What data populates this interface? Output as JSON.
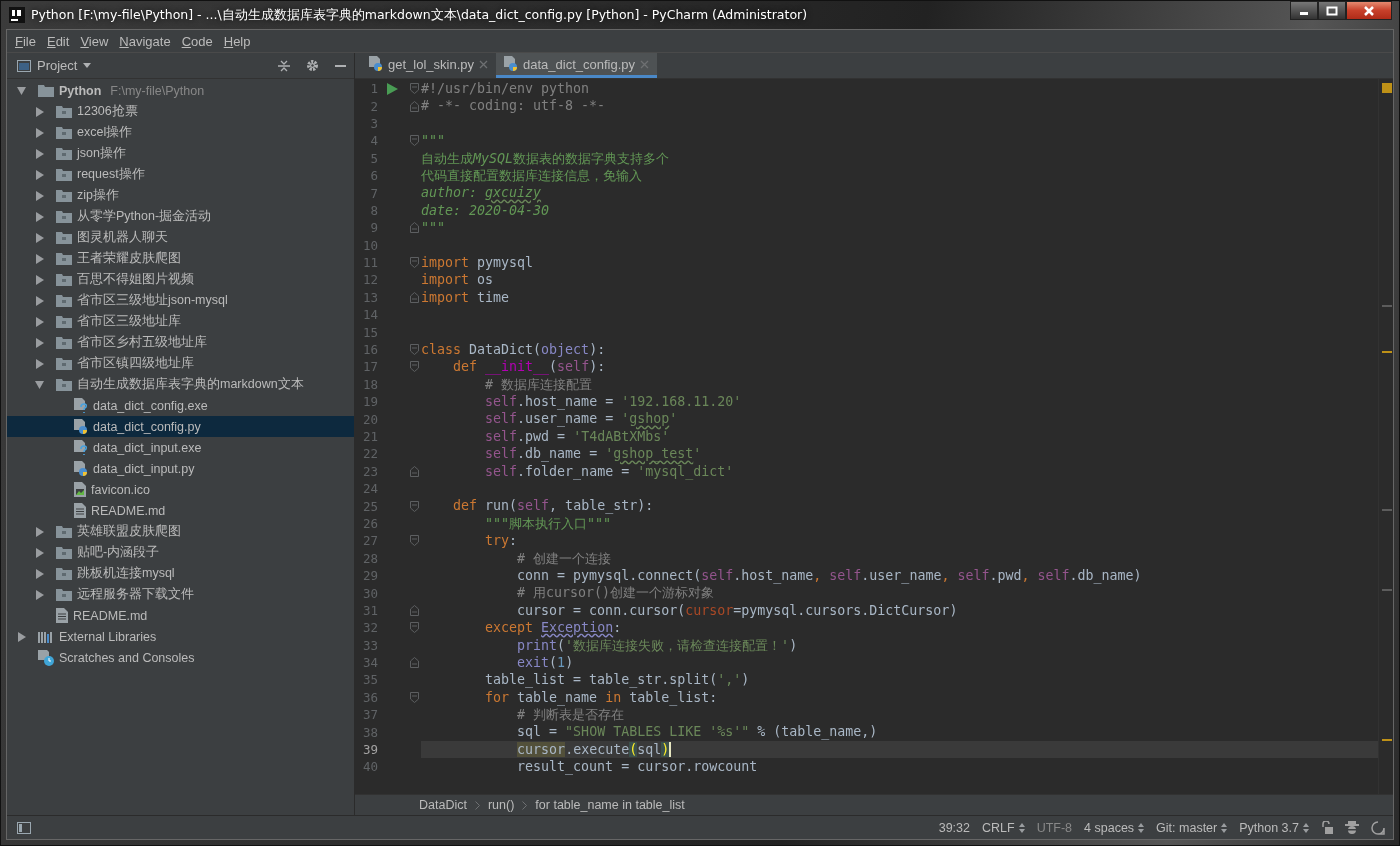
{
  "window": {
    "title": "Python [F:\\my-file\\Python] - ...\\自动生成数据库表字典的markdown文本\\data_dict_config.py [Python] - PyCharm (Administrator)"
  },
  "menu": [
    "File",
    "Edit",
    "View",
    "Navigate",
    "Code",
    "Help"
  ],
  "project_panel": {
    "title": "Project",
    "tree": [
      {
        "label": "Python",
        "hint": "F:\\my-file\\Python",
        "kind": "folder",
        "expanded": true,
        "selected": false,
        "children": [
          {
            "label": "12306抢票",
            "kind": "folder",
            "expanded": false,
            "selected": false
          },
          {
            "label": "excel操作",
            "kind": "folder",
            "expanded": false,
            "selected": false
          },
          {
            "label": "json操作",
            "kind": "folder",
            "expanded": false,
            "selected": false
          },
          {
            "label": "request操作",
            "kind": "folder",
            "expanded": false,
            "selected": false
          },
          {
            "label": "zip操作",
            "kind": "folder",
            "expanded": false,
            "selected": false
          },
          {
            "label": "从零学Python-掘金活动",
            "kind": "folder",
            "expanded": false,
            "selected": false
          },
          {
            "label": "图灵机器人聊天",
            "kind": "folder",
            "expanded": false,
            "selected": false
          },
          {
            "label": "王者荣耀皮肤爬图",
            "kind": "folder",
            "expanded": false,
            "selected": false
          },
          {
            "label": "百思不得姐图片视频",
            "kind": "folder",
            "expanded": false,
            "selected": false
          },
          {
            "label": "省市区三级地址json-mysql",
            "kind": "folder",
            "expanded": false,
            "selected": false
          },
          {
            "label": "省市区三级地址库",
            "kind": "folder",
            "expanded": false,
            "selected": false
          },
          {
            "label": "省市区乡村五级地址库",
            "kind": "folder",
            "expanded": false,
            "selected": false
          },
          {
            "label": "省市区镇四级地址库",
            "kind": "folder",
            "expanded": false,
            "selected": false
          },
          {
            "label": "自动生成数据库表字典的markdown文本",
            "kind": "folder",
            "expanded": true,
            "selected": false,
            "children": [
              {
                "label": "data_dict_config.exe",
                "kind": "exe",
                "selected": false
              },
              {
                "label": "data_dict_config.py",
                "kind": "py",
                "selected": true
              },
              {
                "label": "data_dict_input.exe",
                "kind": "exe",
                "selected": false
              },
              {
                "label": "data_dict_input.py",
                "kind": "py",
                "selected": false
              },
              {
                "label": "favicon.ico",
                "kind": "ico",
                "selected": false
              },
              {
                "label": "README.md",
                "kind": "md",
                "selected": false
              }
            ]
          },
          {
            "label": "英雄联盟皮肤爬图",
            "kind": "folder",
            "expanded": false,
            "selected": false
          },
          {
            "label": "贴吧-内涵段子",
            "kind": "folder",
            "expanded": false,
            "selected": false
          },
          {
            "label": "跳板机连接mysql",
            "kind": "folder",
            "expanded": false,
            "selected": false
          },
          {
            "label": "远程服务器下载文件",
            "kind": "folder",
            "expanded": false,
            "selected": false
          },
          {
            "label": "README.md",
            "kind": "md",
            "selected": false
          }
        ]
      },
      {
        "label": "External Libraries",
        "kind": "libraries",
        "expanded": false,
        "selected": false
      },
      {
        "label": "Scratches and Consoles",
        "kind": "scratches",
        "selected": false
      }
    ]
  },
  "tabs": [
    {
      "label": "get_lol_skin.py",
      "selected": false
    },
    {
      "label": "data_dict_config.py",
      "selected": true
    }
  ],
  "editor": {
    "lines": [
      {
        "n": "1",
        "fold_start": true,
        "run": true,
        "current": false,
        "tokens": [
          {
            "text": "#!/usr/bin/env python",
            "kind": "cmt"
          }
        ]
      },
      {
        "n": "2",
        "fold_end": true,
        "current": false,
        "tokens": [
          {
            "text": "# -*- coding: utf-8 -*-",
            "kind": "cmt"
          }
        ]
      },
      {
        "n": "3",
        "current": false
      },
      {
        "n": "4",
        "fold_start": true,
        "current": false,
        "tokens": [
          {
            "text": "\"\"\"",
            "kind": "doci"
          }
        ]
      },
      {
        "n": "5",
        "current": false,
        "tokens": [
          {
            "text": "自动生成",
            "kind": "doc"
          },
          {
            "text": "MySQL",
            "kind": "doci"
          },
          {
            "text": "数据表的数据字典支持多个",
            "kind": "doc"
          }
        ]
      },
      {
        "n": "6",
        "current": false,
        "tokens": [
          {
            "text": "代码直接配置数据库连接信息，免输入",
            "kind": "doc"
          }
        ]
      },
      {
        "n": "7",
        "current": false,
        "tokens": [
          {
            "text": "author: ",
            "kind": "doci"
          },
          {
            "text": "gxcuizy",
            "kind": "doci",
            "wavy": true
          }
        ]
      },
      {
        "n": "8",
        "current": false,
        "tokens": [
          {
            "text": "date: 2020-04-30",
            "kind": "doci"
          }
        ]
      },
      {
        "n": "9",
        "fold_end": true,
        "current": false,
        "tokens": [
          {
            "text": "\"\"\"",
            "kind": "doci"
          }
        ]
      },
      {
        "n": "10",
        "current": false
      },
      {
        "n": "11",
        "fold_start": true,
        "current": false,
        "tokens": [
          {
            "text": "import",
            "kind": "kw"
          },
          {
            "text": " pymysql",
            "kind": "plain"
          }
        ]
      },
      {
        "n": "12",
        "current": false,
        "tokens": [
          {
            "text": "import",
            "kind": "kw"
          },
          {
            "text": " os",
            "kind": "plain"
          }
        ]
      },
      {
        "n": "13",
        "fold_end": true,
        "current": false,
        "tokens": [
          {
            "text": "import",
            "kind": "kw"
          },
          {
            "text": " time",
            "kind": "plain"
          }
        ]
      },
      {
        "n": "14",
        "current": false
      },
      {
        "n": "15",
        "current": false
      },
      {
        "n": "16",
        "fold_start": true,
        "current": false,
        "tokens": [
          {
            "text": "class",
            "kind": "kw"
          },
          {
            "text": " DataDict(",
            "kind": "plain"
          },
          {
            "text": "object",
            "kind": "builtin"
          },
          {
            "text": "):",
            "kind": "plain"
          }
        ]
      },
      {
        "n": "17",
        "fold_start": true,
        "current": false,
        "tokens": [
          {
            "text": "    def ",
            "kind": "kw"
          },
          {
            "text": "__init__",
            "kind": "dunder"
          },
          {
            "text": "(",
            "kind": "plain"
          },
          {
            "text": "self",
            "kind": "self"
          },
          {
            "text": "):",
            "kind": "plain"
          }
        ]
      },
      {
        "n": "18",
        "current": false,
        "tokens": [
          {
            "text": "        # 数据库连接配置",
            "kind": "cmt"
          }
        ]
      },
      {
        "n": "19",
        "current": false,
        "tokens": [
          {
            "text": "        self",
            "kind": "self"
          },
          {
            "text": ".host_name = ",
            "kind": "plain"
          },
          {
            "text": "'192.168.11.20'",
            "kind": "str"
          }
        ]
      },
      {
        "n": "20",
        "current": false,
        "tokens": [
          {
            "text": "        self",
            "kind": "self"
          },
          {
            "text": ".user_name = ",
            "kind": "plain"
          },
          {
            "text": "'",
            "kind": "str"
          },
          {
            "text": "gshop",
            "kind": "str",
            "wavy": true
          },
          {
            "text": "'",
            "kind": "str"
          }
        ]
      },
      {
        "n": "21",
        "current": false,
        "tokens": [
          {
            "text": "        self",
            "kind": "self"
          },
          {
            "text": ".pwd = ",
            "kind": "plain"
          },
          {
            "text": "'T4dABtXMbs'",
            "kind": "str"
          }
        ]
      },
      {
        "n": "22",
        "current": false,
        "tokens": [
          {
            "text": "        self",
            "kind": "self"
          },
          {
            "text": ".db_name = ",
            "kind": "plain"
          },
          {
            "text": "'",
            "kind": "str"
          },
          {
            "text": "gshop_test",
            "kind": "str",
            "wavy": true
          },
          {
            "text": "'",
            "kind": "str"
          }
        ]
      },
      {
        "n": "23",
        "fold_end": true,
        "current": false,
        "tokens": [
          {
            "text": "        self",
            "kind": "self"
          },
          {
            "text": ".folder_name = ",
            "kind": "plain"
          },
          {
            "text": "'mysql_dict'",
            "kind": "str"
          }
        ]
      },
      {
        "n": "24",
        "current": false
      },
      {
        "n": "25",
        "fold_start": true,
        "current": false,
        "tokens": [
          {
            "text": "    def",
            "kind": "kw"
          },
          {
            "text": " run(",
            "kind": "plain"
          },
          {
            "text": "self",
            "kind": "self"
          },
          {
            "text": ", table_str):",
            "kind": "plain"
          }
        ]
      },
      {
        "n": "26",
        "current": false,
        "tokens": [
          {
            "text": "        \"\"\"脚本执行入口\"\"\"",
            "kind": "doc"
          }
        ]
      },
      {
        "n": "27",
        "fold_start": true,
        "current": false,
        "tokens": [
          {
            "text": "        try",
            "kind": "kw"
          },
          {
            "text": ":",
            "kind": "plain"
          }
        ]
      },
      {
        "n": "28",
        "current": false,
        "tokens": [
          {
            "text": "            # 创建一个连接",
            "kind": "cmt"
          }
        ]
      },
      {
        "n": "29",
        "current": false,
        "tokens": [
          {
            "text": "            conn = pymysql.connect(",
            "kind": "plain"
          },
          {
            "text": "self",
            "kind": "self"
          },
          {
            "text": ".host_name",
            "kind": "plain"
          },
          {
            "text": ", ",
            "kind": "kw"
          },
          {
            "text": "self",
            "kind": "self"
          },
          {
            "text": ".user_name",
            "kind": "plain"
          },
          {
            "text": ", ",
            "kind": "kw"
          },
          {
            "text": "self",
            "kind": "self"
          },
          {
            "text": ".pwd",
            "kind": "plain"
          },
          {
            "text": ", ",
            "kind": "kw"
          },
          {
            "text": "self",
            "kind": "self"
          },
          {
            "text": ".db_name)",
            "kind": "plain"
          }
        ]
      },
      {
        "n": "30",
        "current": false,
        "tokens": [
          {
            "text": "            # 用cursor()创建一个游标对象",
            "kind": "cmt"
          }
        ]
      },
      {
        "n": "31",
        "fold_end": true,
        "current": false,
        "tokens": [
          {
            "text": "            cursor = conn.cursor(",
            "kind": "plain"
          },
          {
            "text": "cursor",
            "kind": "param"
          },
          {
            "text": "=pymysql.cursors.DictCursor)",
            "kind": "plain"
          }
        ]
      },
      {
        "n": "32",
        "fold_start": true,
        "current": false,
        "tokens": [
          {
            "text": "        except ",
            "kind": "kw"
          },
          {
            "text": "Exception",
            "kind": "builtin",
            "wavy": true
          },
          {
            "text": ":",
            "kind": "plain"
          }
        ]
      },
      {
        "n": "33",
        "current": false,
        "tokens": [
          {
            "text": "            print",
            "kind": "builtin"
          },
          {
            "text": "(",
            "kind": "plain"
          },
          {
            "text": "'数据库连接失败，请检查连接配置！'",
            "kind": "str"
          },
          {
            "text": ")",
            "kind": "plain"
          }
        ]
      },
      {
        "n": "34",
        "fold_end": true,
        "current": false,
        "tokens": [
          {
            "text": "            exit",
            "kind": "builtin"
          },
          {
            "text": "(",
            "kind": "plain"
          },
          {
            "text": "1",
            "kind": "num"
          },
          {
            "text": ")",
            "kind": "plain"
          }
        ]
      },
      {
        "n": "35",
        "current": false,
        "tokens": [
          {
            "text": "        table_list = table_str.split(",
            "kind": "plain"
          },
          {
            "text": "','",
            "kind": "str"
          },
          {
            "text": ")",
            "kind": "plain"
          }
        ]
      },
      {
        "n": "36",
        "fold_start": true,
        "current": false,
        "tokens": [
          {
            "text": "        for",
            "kind": "kw"
          },
          {
            "text": " table_name ",
            "kind": "plain"
          },
          {
            "text": "in",
            "kind": "kw"
          },
          {
            "text": " table_list:",
            "kind": "plain"
          }
        ]
      },
      {
        "n": "37",
        "current": false,
        "tokens": [
          {
            "text": "            # 判断表是否存在",
            "kind": "cmt"
          }
        ]
      },
      {
        "n": "38",
        "current": false,
        "tokens": [
          {
            "text": "            sql = ",
            "kind": "plain"
          },
          {
            "text": "\"SHOW TABLES LIKE '%s'\"",
            "kind": "str"
          },
          {
            "text": " % (table_name,)",
            "kind": "plain"
          }
        ]
      },
      {
        "n": "39",
        "current": true,
        "tokens": [
          {
            "text": "            cursor",
            "kind": "usage"
          },
          {
            "text": ".execute",
            "kind": "plain"
          },
          {
            "text": "(",
            "kind": "brace"
          },
          {
            "text": "sql",
            "kind": "plain"
          },
          {
            "text": ")",
            "kind": "brace"
          }
        ]
      },
      {
        "n": "40",
        "current": false,
        "tokens": [
          {
            "text": "            result_count = cursor.rowcount",
            "kind": "plain"
          }
        ]
      }
    ]
  },
  "breadcrumbs": [
    "DataDict",
    "run()",
    "for table_name in table_list"
  ],
  "status_bar": [
    {
      "text": "39:32",
      "dropdown": false,
      "disabled": false
    },
    {
      "text": "CRLF",
      "dropdown": true,
      "disabled": false
    },
    {
      "text": "UTF-8",
      "dropdown": false,
      "disabled": true
    },
    {
      "text": "4 spaces",
      "dropdown": true,
      "disabled": false
    },
    {
      "text": "Git: master",
      "dropdown": true,
      "disabled": false
    },
    {
      "text": "Python 3.7",
      "dropdown": true,
      "disabled": false
    }
  ]
}
